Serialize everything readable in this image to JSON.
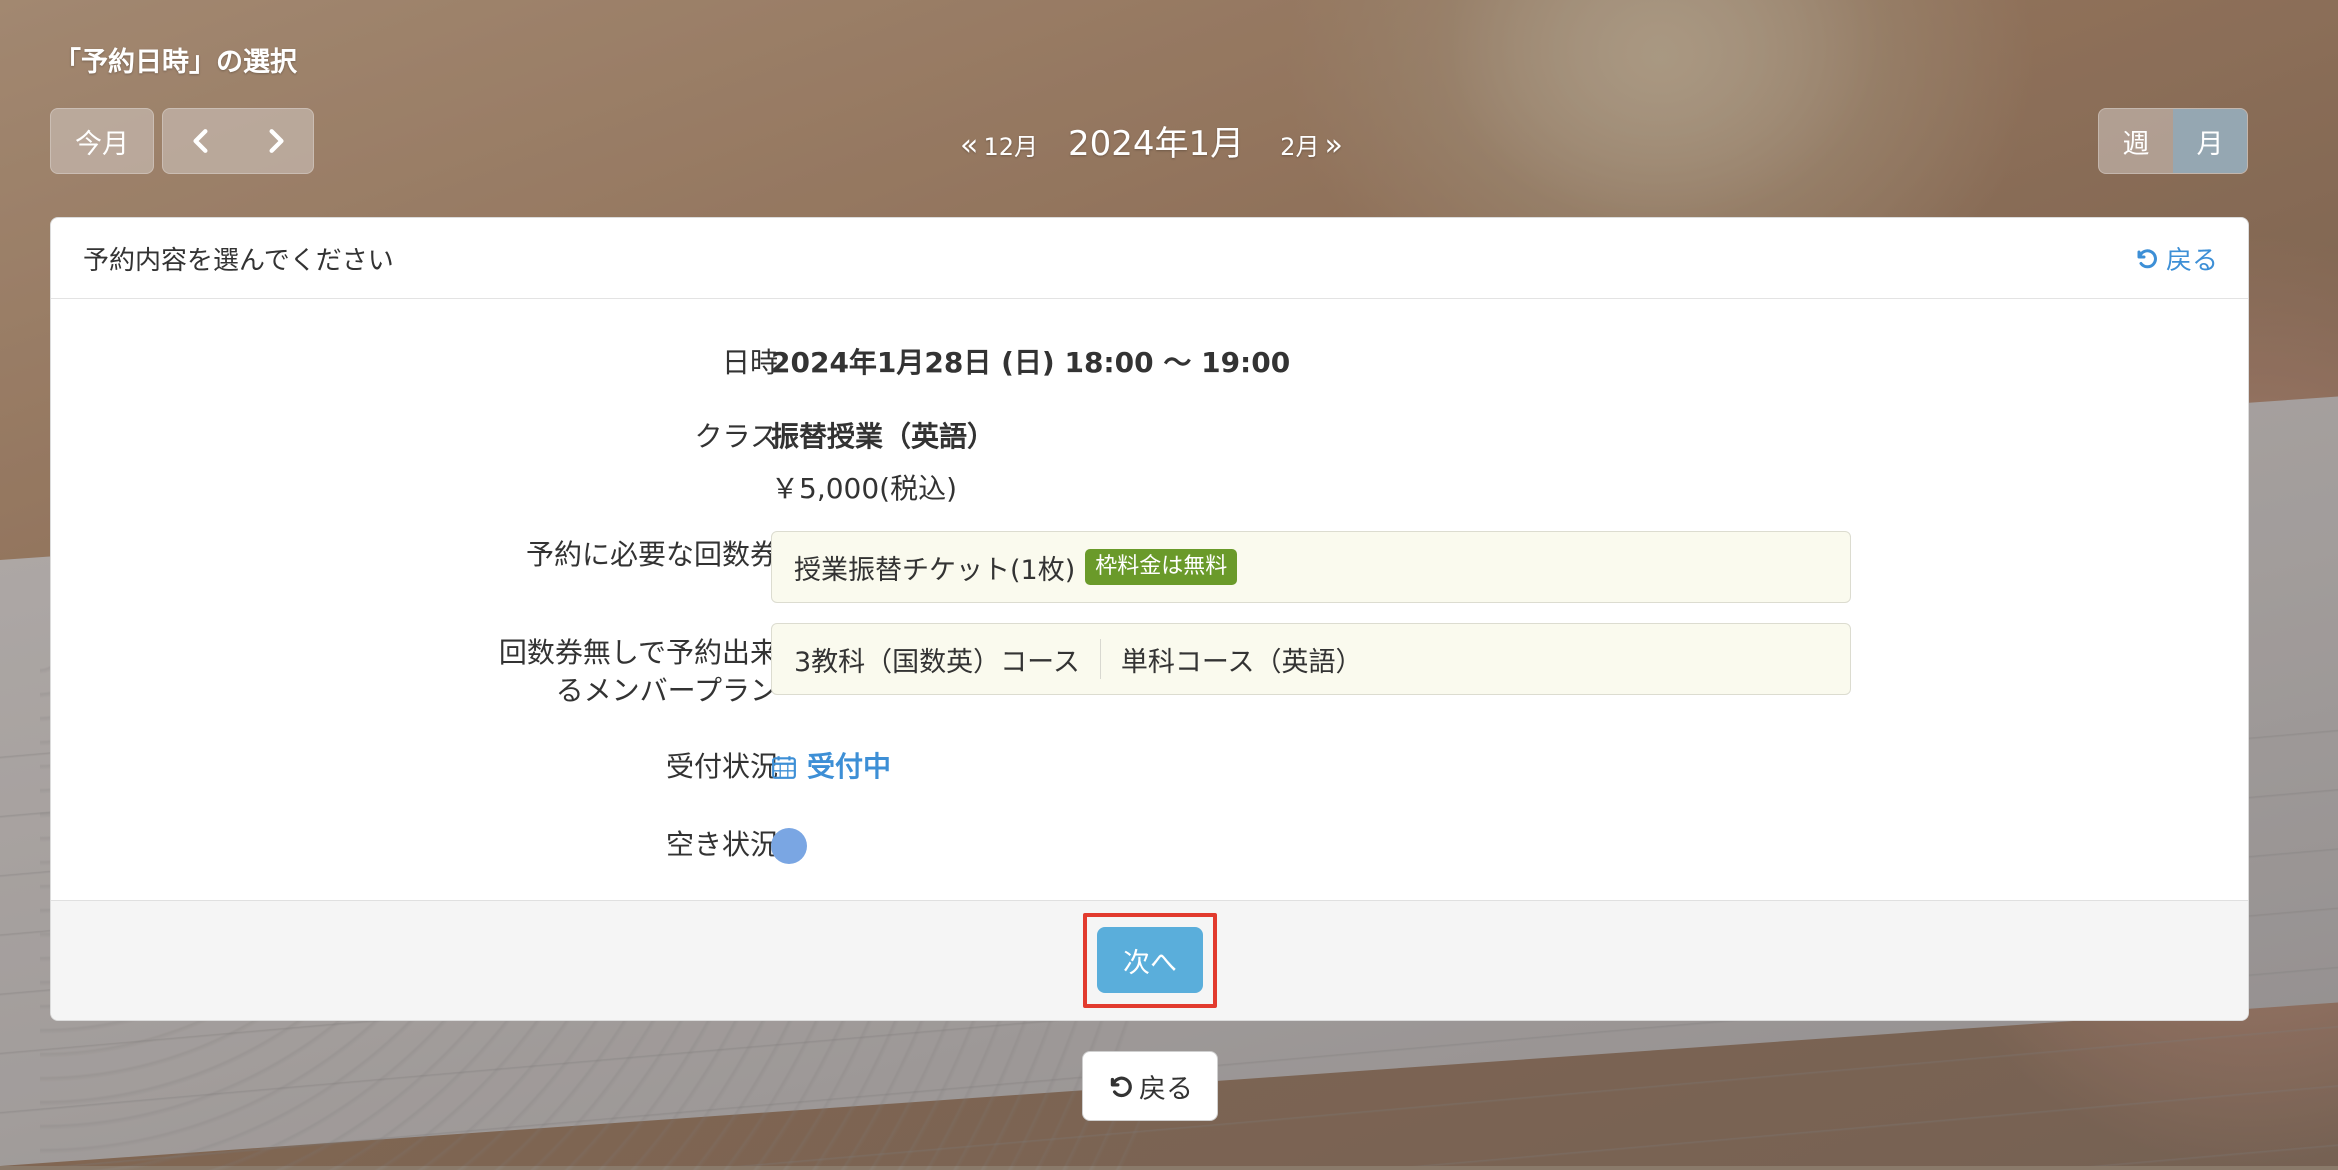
{
  "header": {
    "title": "「予約日時」の選択",
    "today_label": "今月",
    "prev_icon": "chevron-left-icon",
    "next_icon": "chevron-right-icon",
    "prev_month_chev": "«",
    "prev_month": "12月",
    "current_month": "2024年1月",
    "next_month": "2月",
    "next_month_chev": "»",
    "view_week": "週",
    "view_month": "月",
    "active_view": "月"
  },
  "panel": {
    "heading": "予約内容を選んでください",
    "back_link": "戻る",
    "fields": {
      "datetime_label": "日時",
      "datetime_value": "2024年1月28日 (日) 18:00 〜 19:00",
      "class_label": "クラス",
      "class_name": "振替授業（英語）",
      "class_price": "￥5,000(税込)",
      "ticket_label": "予約に必要な回数券",
      "ticket_value": "授業振替チケット(1枚)",
      "ticket_badge": "枠料金は無料",
      "plan_label_line1": "回数券無しで予約出来",
      "plan_label_line2": "るメンバープラン",
      "plans": [
        "3教科（国数英）コース",
        "単科コース（英語）"
      ],
      "reception_label": "受付状況",
      "reception_value": "受付中",
      "availability_label": "空き状況"
    },
    "next_button": "次へ"
  },
  "footer": {
    "back_button": "戻る"
  },
  "colors": {
    "accent_blue": "#3d8fd6",
    "next_button": "#5aaedb",
    "badge_green": "#6a9a2a",
    "availability_dot": "#7aa6e3",
    "highlight_red": "#e23b2e"
  }
}
